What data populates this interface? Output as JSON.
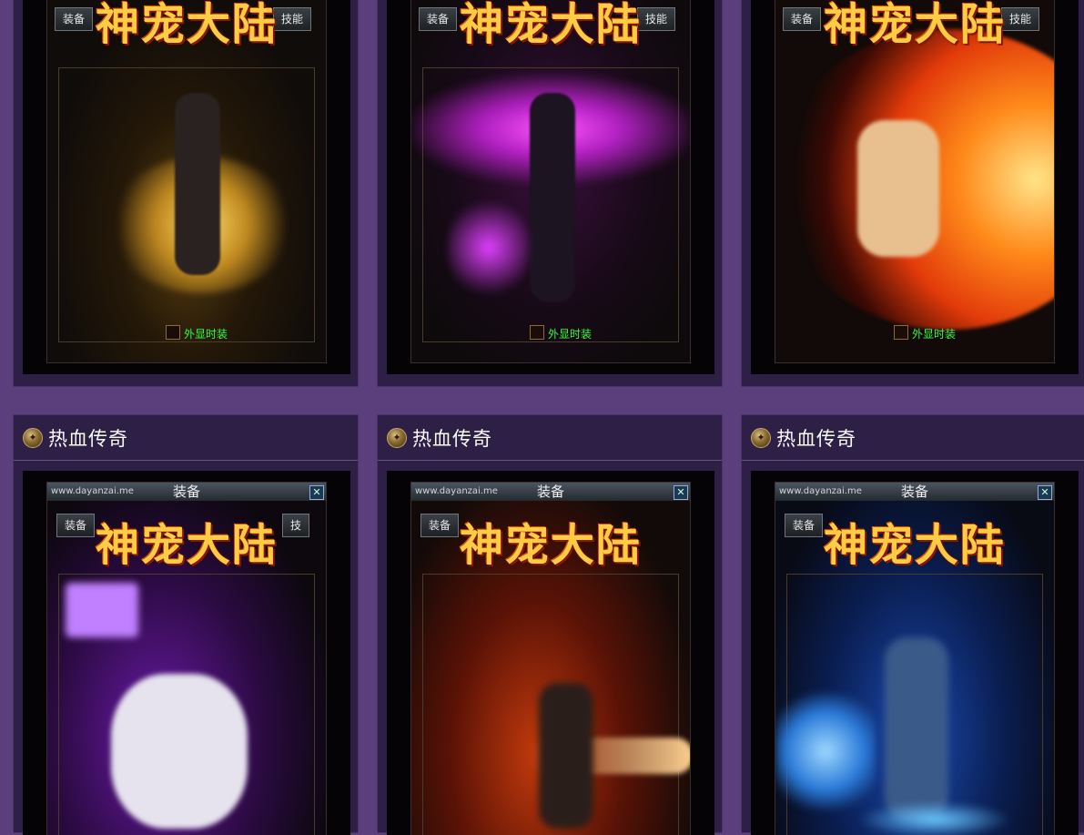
{
  "colors": {
    "page_bg": "#5a3f7c",
    "card_bg": "#2d1f45",
    "checkbox_label": "#33ff33"
  },
  "top_row": [
    {
      "tabs": {
        "left": "装备",
        "right": "技能"
      },
      "logo": "神宠大陆",
      "checkbox_label": "外显时装",
      "theme": "gold"
    },
    {
      "tabs": {
        "left": "装备",
        "right": "技能"
      },
      "logo": "神宠大陆",
      "checkbox_label": "外显时装",
      "theme": "magenta"
    },
    {
      "tabs": {
        "left": "装备",
        "right": "技能"
      },
      "logo": "神宠大陆",
      "checkbox_label": "外显时装",
      "theme": "fire"
    }
  ],
  "bottom_row": [
    {
      "title": "热血传奇",
      "watermark": "www.dayanzai.me",
      "window_title": "装备",
      "tabs": {
        "left": "装备",
        "right": "技"
      },
      "logo": "神宠大陆",
      "icons": {
        "close": "close-icon",
        "header": "medallion-icon"
      },
      "theme": "purple"
    },
    {
      "title": "热血传奇",
      "watermark": "www.dayanzai.me",
      "window_title": "装备",
      "tabs": {
        "left": "装备",
        "right": ""
      },
      "logo": "神宠大陆",
      "icons": {
        "close": "close-icon",
        "header": "medallion-icon"
      },
      "theme": "orange"
    },
    {
      "title": "热血传奇",
      "watermark": "www.dayanzai.me",
      "window_title": "装备",
      "tabs": {
        "left": "装备",
        "right": ""
      },
      "logo": "神宠大陆",
      "icons": {
        "close": "close-icon",
        "header": "medallion-icon"
      },
      "theme": "blue"
    }
  ]
}
